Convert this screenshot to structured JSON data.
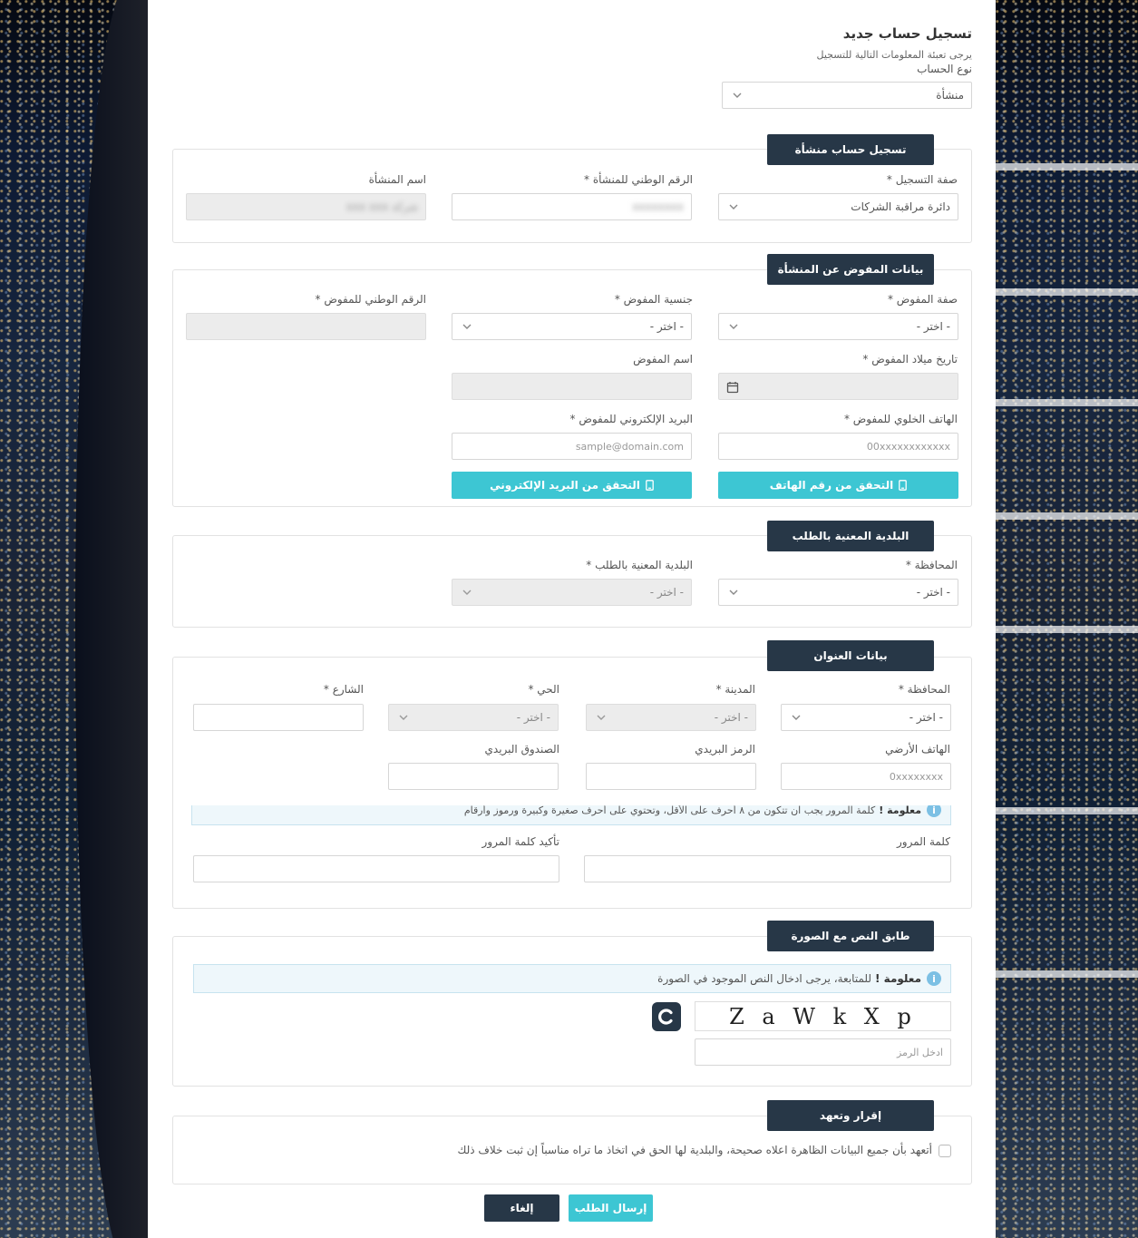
{
  "page": {
    "title": "تسجيل حساب جديد",
    "subtitle": "يرجى تعبئة المعلومات التالية للتسجيل",
    "account_type_label": "نوع الحساب",
    "account_type_value": "منشأة"
  },
  "facility": {
    "heading": "تسجيل حساب منشأة",
    "reg_capacity_label": "صفة التسجيل *",
    "reg_capacity_value": "دائرة مراقبة الشركات",
    "national_no_label": "الرقم الوطني للمنشأة *",
    "national_no_value": "xxxxxxxx",
    "name_label": "اسم المنشأة",
    "name_value": "شركة xxx xxx"
  },
  "delegate": {
    "heading": "بيانات المفوض عن المنشأة",
    "capacity_label": "صفة المفوض *",
    "capacity_value": "- اختر -",
    "nationality_label": "جنسية المفوض *",
    "nationality_value": "- اختر -",
    "national_no_label": "الرقم الوطني للمفوض *",
    "birthdate_label": "تاريخ ميلاد المفوض *",
    "name_label": "اسم المفوض",
    "mobile_label": "الهاتف الخلوي للمفوض *",
    "mobile_placeholder": "00xxxxxxxxxxxx",
    "email_label": "البريد الإلكتروني للمفوض *",
    "email_placeholder": "sample@domain.com",
    "verify_phone": "التحقق من رقم الهاتف",
    "verify_email": "التحقق من البريد الإلكتروني"
  },
  "municipality": {
    "heading": "البلدية المعنية بالطلب",
    "governorate_label": "المحافظة *",
    "governorate_value": "- اختر -",
    "municipality_label": "البلدية المعنية بالطلب *",
    "municipality_value": "- اختر -"
  },
  "address": {
    "heading": "بيانات العنوان",
    "governorate_label": "المحافظة *",
    "governorate_value": "- اختر -",
    "city_label": "المدينة *",
    "city_value": "- اختر -",
    "district_label": "الحي *",
    "district_value": "- اختر -",
    "street_label": "الشارع *",
    "landline_label": "الهاتف الأرضي",
    "landline_placeholder": "0xxxxxxxx",
    "postal_label": "الرمز البريدي",
    "pobox_label": "الصندوق البريدي",
    "password_note_bold": "معلومة !",
    "password_note": "كلمة المرور يجب ان تتكون من ٨ أحرف على الأقل، وتحتوي على أحرف صغيرة وكبيرة ورموز وأرقام",
    "password_label": "كلمة المرور",
    "confirm_password_label": "تأكيد كلمة المرور"
  },
  "captcha": {
    "heading": "طابق النص مع الصورة",
    "info_bold": "معلومة !",
    "info_text": "للمتابعة، يرجى ادخال النص الموجود في الصورة",
    "code": "Z a W k X p",
    "input_placeholder": "ادخل الرمز"
  },
  "declaration": {
    "heading": "إقرار وتعهد",
    "text": "أتعهد بأن جميع البيانات الظاهرة اعلاه صحيحة، والبلدية لها الحق في اتخاذ ما تراه مناسباً إن ثبت خلاف ذلك"
  },
  "actions": {
    "submit": "إرسال الطلب",
    "cancel": "إلغاء"
  }
}
